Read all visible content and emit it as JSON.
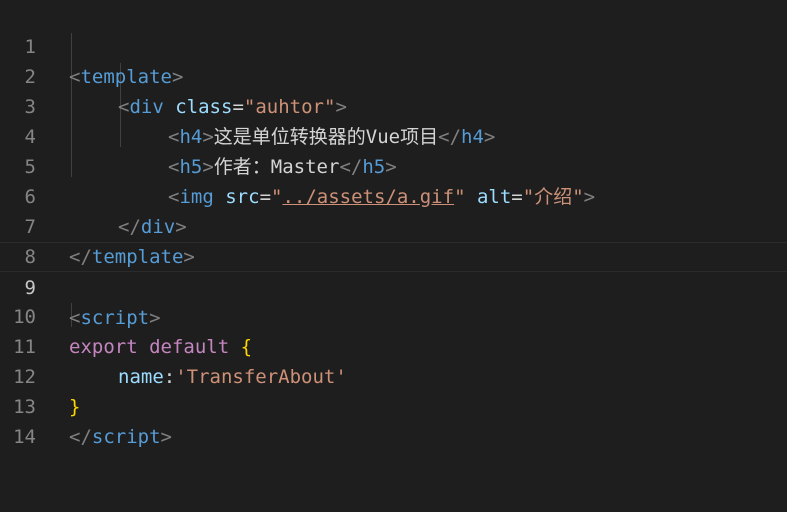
{
  "editor": {
    "line_numbers": [
      "1",
      "2",
      "3",
      "4",
      "5",
      "6",
      "7",
      "8",
      "9",
      "10",
      "11",
      "12",
      "13",
      "14"
    ],
    "tokens": {
      "lt": "<",
      "gt": ">",
      "lt_slash": "</",
      "eq": "=",
      "quote": "\"",
      "colon": ":",
      "space": " ",
      "template": "template",
      "div": "div",
      "class_attr": "class",
      "class_value": "auhtor",
      "h4": "h4",
      "h4_text": "这是单位转换器的Vue项目",
      "h5": "h5",
      "h5_text": "作者：Master",
      "img": "img",
      "src_attr": "src",
      "src_value": "../assets/a.gif",
      "alt_attr": "alt",
      "alt_value": "介绍",
      "script": "script",
      "export": "export",
      "default": "default",
      "brace_open": "{",
      "brace_close": "}",
      "name_key": "name",
      "name_value": "'TransferAbout'"
    }
  }
}
